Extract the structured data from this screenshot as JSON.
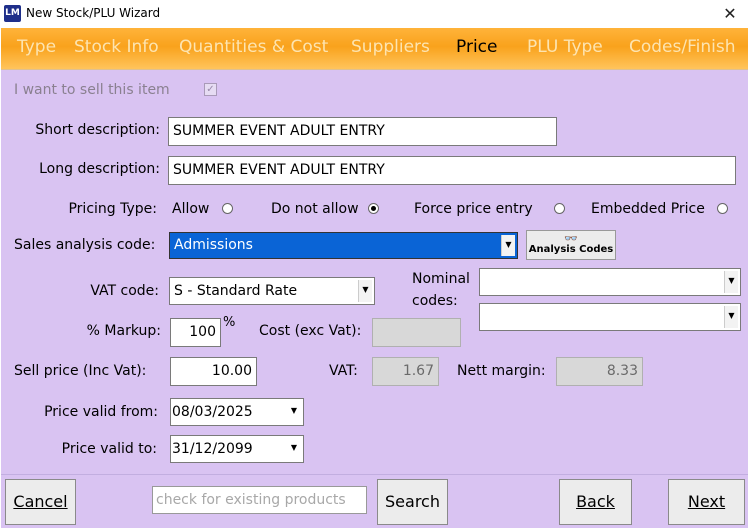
{
  "window": {
    "icon_text": "LM",
    "title": "New Stock/PLU Wizard",
    "close_glyph": "✕"
  },
  "tabs": [
    {
      "label": "Type",
      "active": false
    },
    {
      "label": "Stock Info",
      "active": false
    },
    {
      "label": "Quantities & Cost",
      "active": false
    },
    {
      "label": "Suppliers",
      "active": false
    },
    {
      "label": "Price",
      "active": true
    },
    {
      "label": "PLU Type",
      "active": false
    },
    {
      "label": "Codes/Finish",
      "active": false
    }
  ],
  "form": {
    "sell_item_label": "I want to sell this item",
    "sell_item_checked": true,
    "short_desc_label": "Short description:",
    "short_desc_value": "SUMMER EVENT ADULT ENTRY",
    "long_desc_label": "Long description:",
    "long_desc_value": "SUMMER EVENT ADULT ENTRY",
    "pricing_type_label": "Pricing Type:",
    "pricing_options": [
      {
        "label": "Allow",
        "selected": false
      },
      {
        "label": "Do not allow",
        "selected": true
      },
      {
        "label": "Force price entry",
        "selected": false
      },
      {
        "label": "Embedded Price",
        "selected": false
      }
    ],
    "sales_analysis_label": "Sales analysis code:",
    "sales_analysis_value": "Admissions",
    "analysis_codes_button": "Analysis Codes",
    "vat_code_label": "VAT code:",
    "vat_code_value": "S - Standard Rate",
    "nominal_label_1": "Nominal",
    "nominal_label_2": "codes:",
    "nominal_value_1": "",
    "nominal_value_2": "",
    "markup_label": "% Markup:",
    "markup_value": "100",
    "markup_suffix": "%",
    "cost_label": "Cost (exc Vat):",
    "cost_value": "",
    "sell_price_label": "Sell price (Inc Vat):",
    "sell_price_value": "10.00",
    "vat_label": "VAT:",
    "vat_value": "1.67",
    "nett_margin_label": "Nett margin:",
    "nett_margin_value": "8.33",
    "valid_from_label": "Price valid from:",
    "valid_from_value": "08/03/2025",
    "valid_to_label": "Price valid to:",
    "valid_to_value": "31/12/2099"
  },
  "footer": {
    "cancel_button": "Cancel",
    "search_placeholder": "check for existing products",
    "search_button": "Search",
    "back_button": "Back",
    "next_button": "Next"
  },
  "colors": {
    "tab_bar": "#f9a21c",
    "content_bg": "#d9c3f2",
    "selection": "#0a64d6"
  }
}
